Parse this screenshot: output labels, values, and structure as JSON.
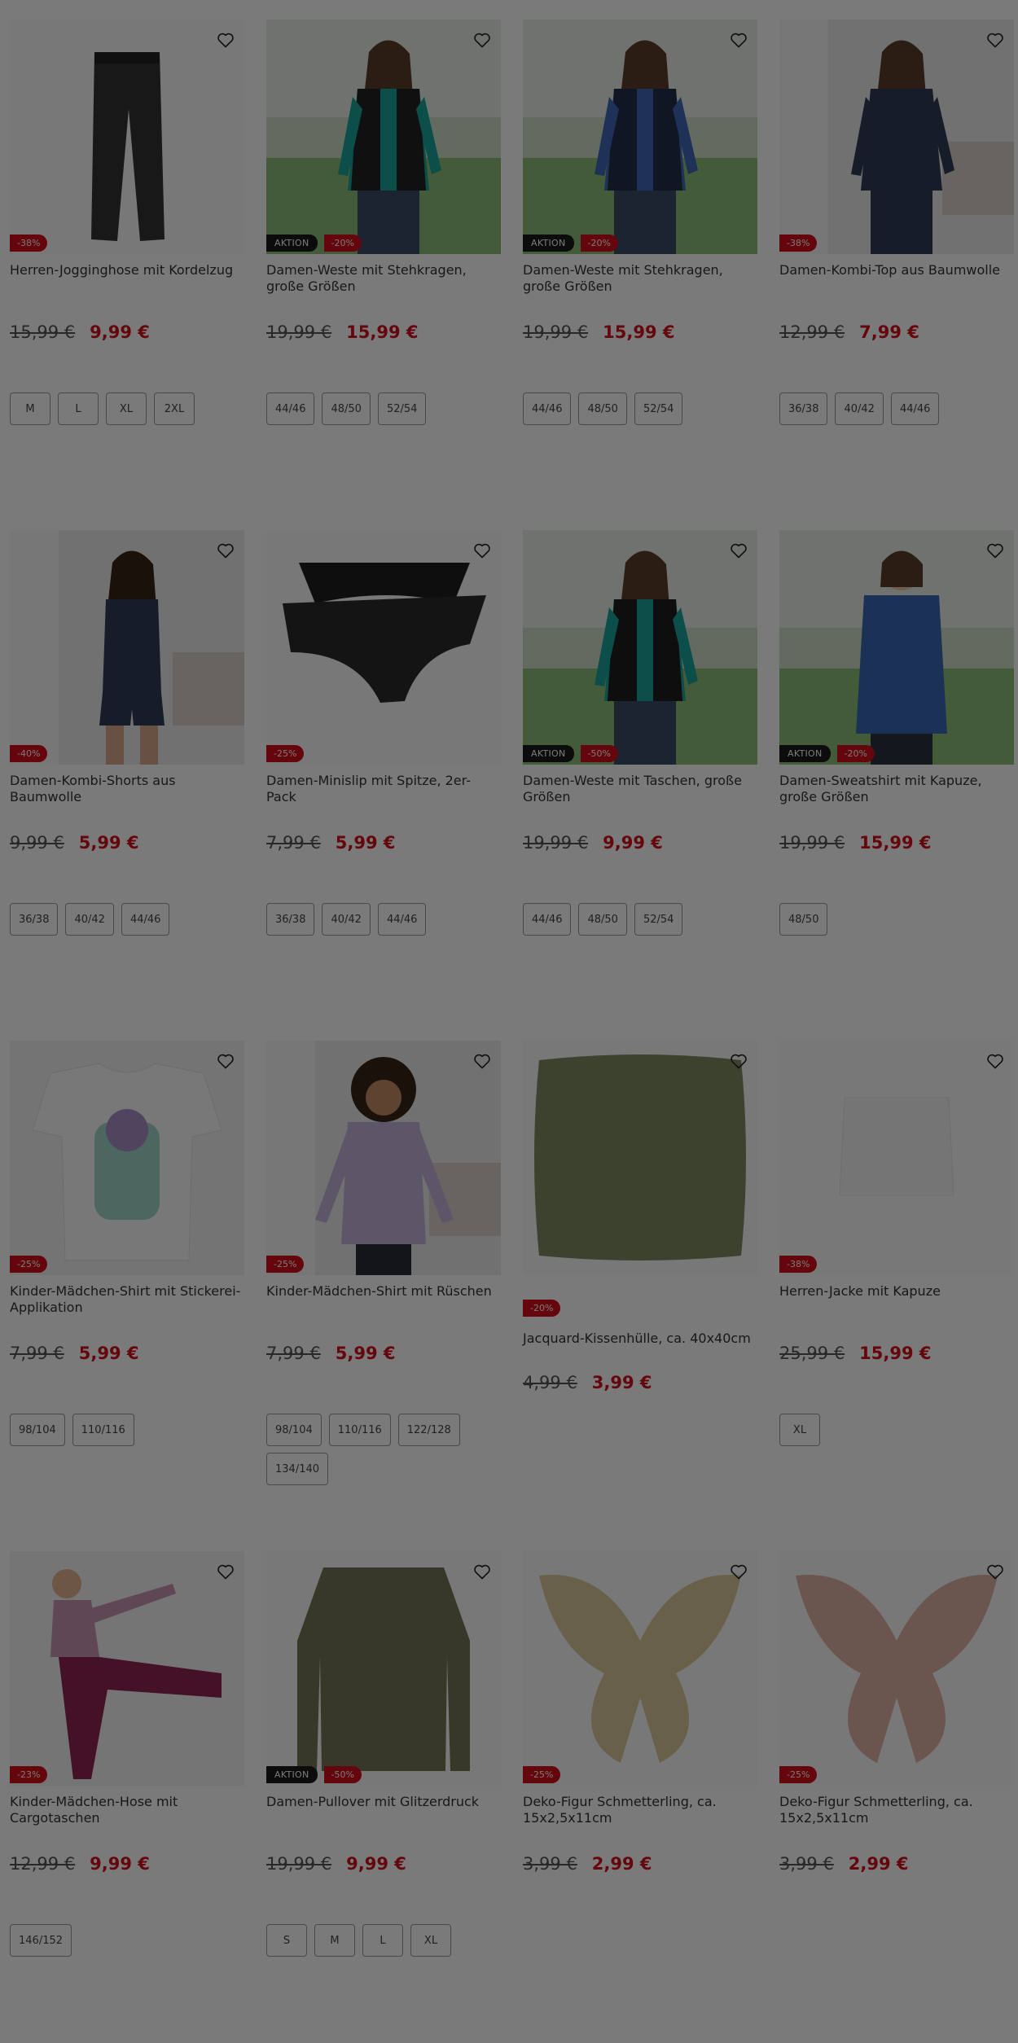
{
  "colors": {
    "accent_red": "#d10d1b",
    "overlay": "rgba(0,0,0,0.52)"
  },
  "products": [
    {
      "title": "Herren-Jogginghose mit Kordelzug",
      "aktion": "",
      "discount": "-38%",
      "old_price": "15,99 €",
      "new_price": "9,99 €",
      "sizes": [
        "M",
        "L",
        "XL",
        "2XL"
      ],
      "image": "pants-black"
    },
    {
      "title": "Damen-Weste mit Stehkragen, große Größen",
      "aktion": "AKTION",
      "discount": "-20%",
      "old_price": "19,99 €",
      "new_price": "15,99 €",
      "sizes": [
        "44/46",
        "48/50",
        "52/54"
      ],
      "image": "woman-vest-teal"
    },
    {
      "title": "Damen-Weste mit Stehkragen, große Größen",
      "aktion": "AKTION",
      "discount": "-20%",
      "old_price": "19,99 €",
      "new_price": "15,99 €",
      "sizes": [
        "44/46",
        "48/50",
        "52/54"
      ],
      "image": "woman-vest-blue"
    },
    {
      "title": "Damen-Kombi-Top aus Baumwolle",
      "aktion": "",
      "discount": "-38%",
      "old_price": "12,99 €",
      "new_price": "7,99 €",
      "sizes": [
        "36/38",
        "40/42",
        "44/46"
      ],
      "image": "woman-top"
    },
    {
      "title": "Damen-Kombi-Shorts aus Baumwolle",
      "aktion": "",
      "discount": "-40%",
      "old_price": "9,99 €",
      "new_price": "5,99 €",
      "sizes": [
        "36/38",
        "40/42",
        "44/46"
      ],
      "image": "woman-shorts"
    },
    {
      "title": "Damen-Minislip mit Spitze, 2er-Pack",
      "aktion": "",
      "discount": "-25%",
      "old_price": "7,99 €",
      "new_price": "5,99 €",
      "sizes": [
        "36/38",
        "40/42",
        "44/46"
      ],
      "image": "briefs-black"
    },
    {
      "title": "Damen-Weste mit Taschen, große Größen",
      "aktion": "AKTION",
      "discount": "-50%",
      "old_price": "19,99 €",
      "new_price": "9,99 €",
      "sizes": [
        "44/46",
        "48/50",
        "52/54"
      ],
      "image": "woman-vest-pockets"
    },
    {
      "title": "Damen-Sweatshirt mit Kapuze, große Größen",
      "aktion": "AKTION",
      "discount": "-20%",
      "old_price": "19,99 €",
      "new_price": "15,99 €",
      "sizes": [
        "48/50"
      ],
      "image": "woman-hoodie"
    },
    {
      "title": "Kinder-Mädchen-Shirt mit Stickerei-Applikation",
      "aktion": "",
      "discount": "-25%",
      "old_price": "7,99 €",
      "new_price": "5,99 €",
      "sizes": [
        "98/104",
        "110/116"
      ],
      "image": "kids-shirt-white"
    },
    {
      "title": "Kinder-Mädchen-Shirt mit Rüschen",
      "aktion": "",
      "discount": "-25%",
      "old_price": "7,99 €",
      "new_price": "5,99 €",
      "sizes": [
        "98/104",
        "110/116",
        "122/128",
        "134/140"
      ],
      "image": "girl-shirt-lilac"
    },
    {
      "title": "Jacquard-Kissenhülle, ca. 40x40cm",
      "aktion": "",
      "discount": "-20%",
      "old_price": "4,99 €",
      "new_price": "3,99 €",
      "sizes": [],
      "image": "pillow-olive"
    },
    {
      "title": "Herren-Jacke mit Kapuze",
      "aktion": "",
      "discount": "-38%",
      "old_price": "25,99 €",
      "new_price": "15,99 €",
      "sizes": [
        "XL"
      ],
      "image": "jacket-white"
    },
    {
      "title": "Kinder-Mädchen-Hose mit Cargotaschen",
      "aktion": "",
      "discount": "-23%",
      "old_price": "12,99 €",
      "new_price": "9,99 €",
      "sizes": [
        "146/152"
      ],
      "image": "girl-cargo"
    },
    {
      "title": "Damen-Pullover mit Glitzerdruck",
      "aktion": "AKTION",
      "discount": "-50%",
      "old_price": "19,99 €",
      "new_price": "9,99 €",
      "sizes": [
        "S",
        "M",
        "L",
        "XL"
      ],
      "image": "pullover-olive"
    },
    {
      "title": "Deko-Figur Schmetterling, ca. 15x2,5x11cm",
      "aktion": "",
      "discount": "-25%",
      "old_price": "3,99 €",
      "new_price": "2,99 €",
      "sizes": [],
      "image": "butterfly-cream"
    },
    {
      "title": "Deko-Figur Schmetterling, ca. 15x2,5x11cm",
      "aktion": "",
      "discount": "-25%",
      "old_price": "3,99 €",
      "new_price": "2,99 €",
      "sizes": [],
      "image": "butterfly-pink"
    }
  ]
}
